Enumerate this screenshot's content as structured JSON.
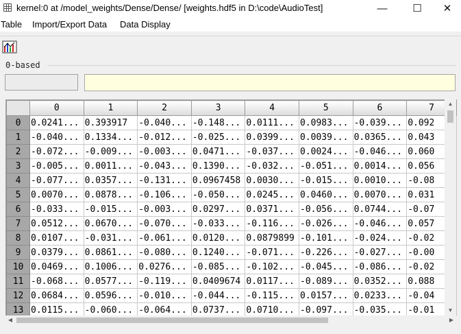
{
  "window": {
    "title": "kernel:0  at  /model_weights/Dense/Dense/  [weights.hdf5  in  D:\\code\\AudioTest]",
    "minimize": "—",
    "maximize": "☐",
    "close": "✕"
  },
  "menu": [
    "Table",
    "Import/Export Data",
    "Data Display"
  ],
  "toolbar": {
    "chart_icon": "chart-icon"
  },
  "index_label": "0-based",
  "cell_name": "",
  "cell_value": "",
  "table": {
    "columns": [
      "0",
      "1",
      "2",
      "3",
      "4",
      "5",
      "6",
      "7"
    ],
    "rows": [
      {
        "i": "0",
        "v": [
          "0.0241...",
          "0.393917",
          "-0.040...",
          "-0.148...",
          "0.0111...",
          "0.0983...",
          "-0.039...",
          "0.092"
        ]
      },
      {
        "i": "1",
        "v": [
          "-0.040...",
          "0.1334...",
          "-0.012...",
          "-0.025...",
          "0.0399...",
          "0.0039...",
          "0.0365...",
          "0.043"
        ]
      },
      {
        "i": "2",
        "v": [
          "-0.072...",
          "-0.009...",
          "-0.003...",
          "0.0471...",
          "-0.037...",
          "0.0024...",
          "-0.046...",
          "0.060"
        ]
      },
      {
        "i": "3",
        "v": [
          "-0.005...",
          "0.0011...",
          "-0.043...",
          "0.1390...",
          "-0.032...",
          "-0.051...",
          "0.0014...",
          "0.056"
        ]
      },
      {
        "i": "4",
        "v": [
          "-0.077...",
          "0.0357...",
          "-0.131...",
          "0.0967458",
          "0.0030...",
          "-0.015...",
          "0.0010...",
          "-0.08"
        ]
      },
      {
        "i": "5",
        "v": [
          "0.0070...",
          "0.0878...",
          "-0.106...",
          "-0.050...",
          "0.0245...",
          "0.0460...",
          "0.0070...",
          "0.031"
        ]
      },
      {
        "i": "6",
        "v": [
          "-0.033...",
          "-0.015...",
          "-0.003...",
          "0.0297...",
          "0.0371...",
          "-0.056...",
          "0.0744...",
          "-0.07"
        ]
      },
      {
        "i": "7",
        "v": [
          "0.0512...",
          "0.0670...",
          "-0.070...",
          "-0.033...",
          "-0.116...",
          "-0.026...",
          "-0.046...",
          "0.057"
        ]
      },
      {
        "i": "8",
        "v": [
          "0.0107...",
          "-0.031...",
          "-0.061...",
          "0.0120...",
          "0.0879899",
          "-0.101...",
          "-0.024...",
          "-0.02"
        ]
      },
      {
        "i": "9",
        "v": [
          "0.0379...",
          "0.0861...",
          "-0.080...",
          "0.1240...",
          "-0.071...",
          "-0.226...",
          "-0.027...",
          "-0.00"
        ]
      },
      {
        "i": "10",
        "v": [
          "0.0469...",
          "0.1006...",
          "0.0276...",
          "-0.085...",
          "-0.102...",
          "-0.045...",
          "-0.086...",
          "-0.02"
        ]
      },
      {
        "i": "11",
        "v": [
          "-0.068...",
          "0.0577...",
          "-0.119...",
          "0.0409674",
          "0.0117...",
          "-0.089...",
          "0.0352...",
          "0.088"
        ]
      },
      {
        "i": "12",
        "v": [
          "0.0684...",
          "0.0596...",
          "-0.010...",
          "-0.044...",
          "-0.115...",
          "0.0157...",
          "0.0233...",
          "-0.04"
        ]
      },
      {
        "i": "13",
        "v": [
          "0.0115...",
          "-0.060...",
          "-0.064...",
          "0.0737...",
          "0.0710...",
          "-0.097...",
          "-0.035...",
          "-0.01"
        ]
      }
    ]
  },
  "scroll": {
    "up": "▲",
    "down": "▼",
    "left": "◀",
    "right": "▶"
  },
  "colors": {
    "cell_value_bg": "#ffffe0",
    "row_header_bg": "#a8a8a8"
  }
}
